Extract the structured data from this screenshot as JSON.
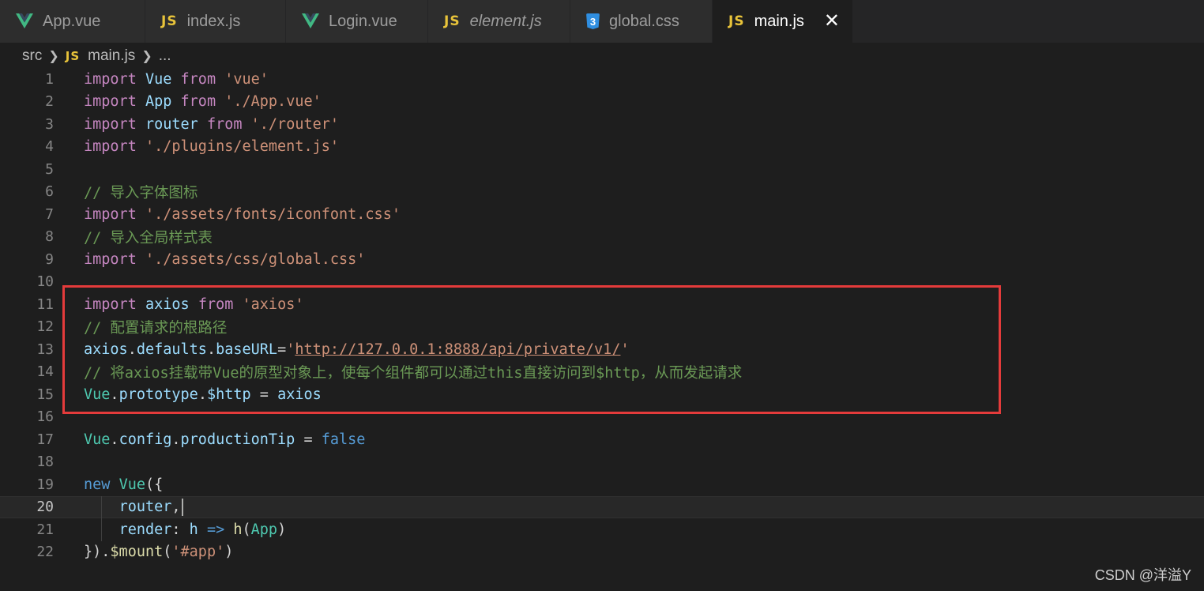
{
  "tabs": [
    {
      "label": "App.vue",
      "icon": "vue-icon",
      "italic": false,
      "active": false
    },
    {
      "label": "index.js",
      "icon": "js-icon",
      "italic": false,
      "active": false
    },
    {
      "label": "Login.vue",
      "icon": "vue-icon",
      "italic": false,
      "active": false
    },
    {
      "label": "element.js",
      "icon": "js-icon",
      "italic": true,
      "active": false
    },
    {
      "label": "global.css",
      "icon": "css-icon",
      "italic": false,
      "active": false
    },
    {
      "label": "main.js",
      "icon": "js-icon",
      "italic": false,
      "active": true
    }
  ],
  "tab_icon_text": {
    "js": "JS",
    "css": "3"
  },
  "tab_close_glyph": "✕",
  "breadcrumb": {
    "root": "src",
    "file": "main.js",
    "more": "..."
  },
  "editor": {
    "current_line": 20,
    "highlighted_lines": [
      11,
      15
    ],
    "lines": [
      {
        "n": "1",
        "tokens": [
          [
            "kw",
            "import"
          ],
          [
            "op",
            " "
          ],
          [
            "id",
            "Vue"
          ],
          [
            "op",
            " "
          ],
          [
            "kw",
            "from"
          ],
          [
            "op",
            " "
          ],
          [
            "str",
            "'vue'"
          ]
        ]
      },
      {
        "n": "2",
        "tokens": [
          [
            "kw",
            "import"
          ],
          [
            "op",
            " "
          ],
          [
            "id",
            "App"
          ],
          [
            "op",
            " "
          ],
          [
            "kw",
            "from"
          ],
          [
            "op",
            " "
          ],
          [
            "str",
            "'./App.vue'"
          ]
        ]
      },
      {
        "n": "3",
        "tokens": [
          [
            "kw",
            "import"
          ],
          [
            "op",
            " "
          ],
          [
            "id",
            "router"
          ],
          [
            "op",
            " "
          ],
          [
            "kw",
            "from"
          ],
          [
            "op",
            " "
          ],
          [
            "str",
            "'./router'"
          ]
        ]
      },
      {
        "n": "4",
        "tokens": [
          [
            "kw",
            "import"
          ],
          [
            "op",
            " "
          ],
          [
            "str",
            "'./plugins/element.js'"
          ]
        ]
      },
      {
        "n": "5",
        "tokens": []
      },
      {
        "n": "6",
        "tokens": [
          [
            "cmt",
            "// 导入字体图标"
          ]
        ]
      },
      {
        "n": "7",
        "tokens": [
          [
            "kw",
            "import"
          ],
          [
            "op",
            " "
          ],
          [
            "str",
            "'./assets/fonts/iconfont.css'"
          ]
        ]
      },
      {
        "n": "8",
        "tokens": [
          [
            "cmt",
            "// 导入全局样式表"
          ]
        ]
      },
      {
        "n": "9",
        "tokens": [
          [
            "kw",
            "import"
          ],
          [
            "op",
            " "
          ],
          [
            "str",
            "'./assets/css/global.css'"
          ]
        ]
      },
      {
        "n": "10",
        "tokens": []
      },
      {
        "n": "11",
        "tokens": [
          [
            "kw",
            "import"
          ],
          [
            "op",
            " "
          ],
          [
            "id",
            "axios"
          ],
          [
            "op",
            " "
          ],
          [
            "kw",
            "from"
          ],
          [
            "op",
            " "
          ],
          [
            "str",
            "'axios'"
          ]
        ]
      },
      {
        "n": "12",
        "tokens": [
          [
            "cmt",
            "// 配置请求的根路径"
          ]
        ]
      },
      {
        "n": "13",
        "tokens": [
          [
            "id",
            "axios"
          ],
          [
            "op",
            "."
          ],
          [
            "id",
            "defaults"
          ],
          [
            "op",
            "."
          ],
          [
            "id",
            "baseURL"
          ],
          [
            "op",
            "="
          ],
          [
            "str",
            "'"
          ],
          [
            "str url",
            "http://127.0.0.1:8888/api/private/v1/"
          ],
          [
            "str",
            "'"
          ]
        ]
      },
      {
        "n": "14",
        "tokens": [
          [
            "cmt",
            "// 将axios挂载带Vue的原型对象上，使每个组件都可以通过this直接访问到$http，从而发起请求"
          ]
        ]
      },
      {
        "n": "15",
        "tokens": [
          [
            "cls",
            "Vue"
          ],
          [
            "op",
            "."
          ],
          [
            "id",
            "prototype"
          ],
          [
            "op",
            "."
          ],
          [
            "id",
            "$http"
          ],
          [
            "op",
            " = "
          ],
          [
            "id",
            "axios"
          ]
        ]
      },
      {
        "n": "16",
        "tokens": []
      },
      {
        "n": "17",
        "tokens": [
          [
            "cls",
            "Vue"
          ],
          [
            "op",
            "."
          ],
          [
            "id",
            "config"
          ],
          [
            "op",
            "."
          ],
          [
            "id",
            "productionTip"
          ],
          [
            "op",
            " = "
          ],
          [
            "kw2",
            "false"
          ]
        ]
      },
      {
        "n": "18",
        "tokens": []
      },
      {
        "n": "19",
        "tokens": [
          [
            "kw2",
            "new"
          ],
          [
            "op",
            " "
          ],
          [
            "cls",
            "Vue"
          ],
          [
            "op",
            "({"
          ]
        ]
      },
      {
        "n": "20",
        "tokens": [
          [
            "op",
            "    "
          ],
          [
            "id",
            "router"
          ],
          [
            "op",
            ","
          ]
        ]
      },
      {
        "n": "21",
        "tokens": [
          [
            "op",
            "    "
          ],
          [
            "id",
            "render"
          ],
          [
            "op",
            ": "
          ],
          [
            "id",
            "h"
          ],
          [
            "op",
            " "
          ],
          [
            "kw2",
            "=>"
          ],
          [
            "op",
            " "
          ],
          [
            "fn",
            "h"
          ],
          [
            "op",
            "("
          ],
          [
            "cls",
            "App"
          ],
          [
            "op",
            ")"
          ]
        ]
      },
      {
        "n": "22",
        "tokens": [
          [
            "op",
            "})."
          ],
          [
            "fn",
            "$mount"
          ],
          [
            "op",
            "("
          ],
          [
            "str",
            "'#app'"
          ],
          [
            "op",
            ")"
          ]
        ]
      }
    ]
  },
  "watermark": "CSDN @洋溢Y"
}
